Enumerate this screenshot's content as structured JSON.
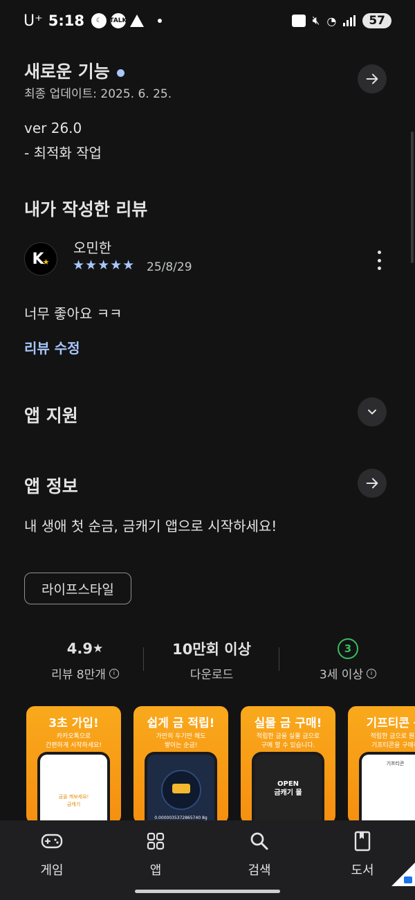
{
  "status_bar": {
    "carrier": "U⁺",
    "time": "5:18",
    "talk_label": "TALK",
    "battery": "57"
  },
  "whats_new": {
    "title": "새로운 기능",
    "updated": "최종 업데이트: 2025. 6. 25.",
    "version": "ver 26.0",
    "notes": "- 최적화 작업"
  },
  "my_review": {
    "heading": "내가 작성한 리뷰",
    "avatar_letter": "K",
    "author": "오민한",
    "stars": "★★★★★",
    "rating": 5,
    "date": "25/8/29",
    "text": "너무 좋아요 ㅋㅋ",
    "edit_label": "리뷰 수정"
  },
  "app_support": {
    "heading": "앱 지원"
  },
  "app_info": {
    "heading": "앱 정보",
    "description": "내 생애 첫 순금, 금캐기 앱으로 시작하세요!",
    "category_chip": "라이프스타일"
  },
  "stats": {
    "rating_value": "4.9",
    "rating_star": "★",
    "rating_label": "리뷰 8만개",
    "downloads_value": "10만회 이상",
    "downloads_label": "다운로드",
    "age_value": "3",
    "age_label": "3세 이상"
  },
  "screenshots": [
    {
      "title": "3초 가입!",
      "desc": "카카오톡으로\n간편하게 시작하세요!",
      "screen_text": "금을 캐보세요!\n금캐기"
    },
    {
      "title": "쉽게 금 적립!",
      "desc": "가만히 두기만 해도\n쌓이는 순금!",
      "screen_text": "0.0000035372865740 8g"
    },
    {
      "title": "실물 금 구매!",
      "desc": "적립한 금을 실물 금으로\n구매 할 수 있습니다.",
      "screen_text": "OPEN\n금캐기 몰"
    },
    {
      "title": "기프티콘 구",
      "desc": "적립한 금으로 원하\n기프티콘을 구매하",
      "screen_text": "기프티콘"
    }
  ],
  "bottom_nav": [
    {
      "label": "게임",
      "icon": "gamepad-icon"
    },
    {
      "label": "앱",
      "icon": "apps-grid-icon"
    },
    {
      "label": "검색",
      "icon": "search-icon"
    },
    {
      "label": "도서",
      "icon": "book-icon"
    }
  ],
  "colors": {
    "background": "#131314",
    "accent_blue": "#a8c7fa",
    "age_green": "#37be5f",
    "screenshot_orange": "#f9a91c"
  }
}
